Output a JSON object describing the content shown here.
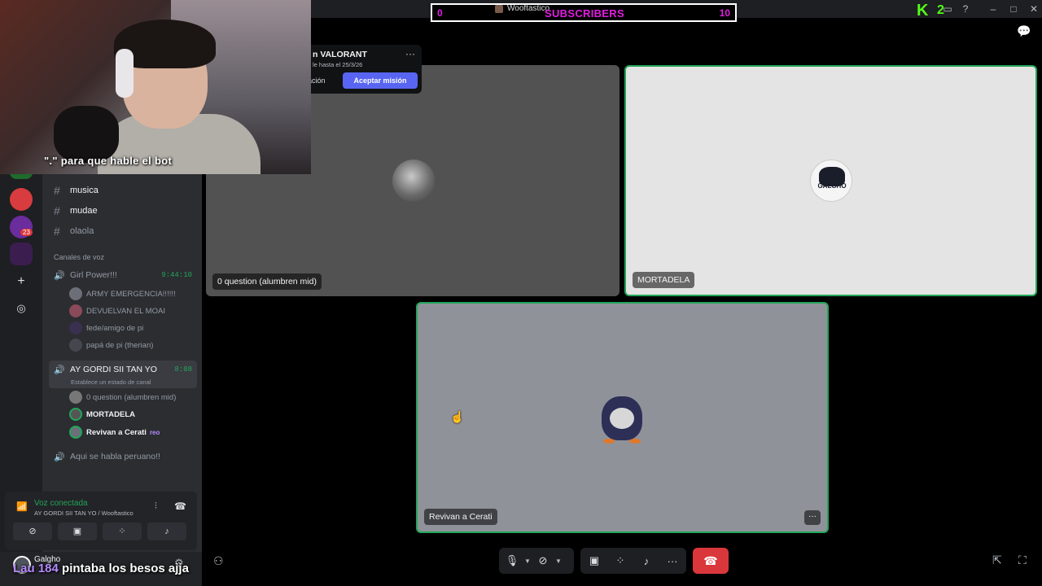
{
  "overlay": {
    "subscribers_label": "SUBSCRIBERS",
    "subscribers_left": "0",
    "subscribers_right": "10",
    "stream_user": "Wooftastico",
    "k_count": "2",
    "webcam_caption": "\".\" para que hable el bot",
    "bottom_caption_prefix": "Lau 184",
    "bottom_caption_text": "pintaba los besos ajja"
  },
  "mission": {
    "title": "n VALORANT",
    "subtitle": "le hasta el 25/3/26",
    "secondary_button": "ación",
    "primary_button": "Aceptar misión"
  },
  "channels": {
    "text": [
      {
        "name": "musica"
      },
      {
        "name": "mudae"
      },
      {
        "name": "olaola"
      }
    ],
    "voice_category": "Canales de voz",
    "voice": [
      {
        "name": "Girl Power!!!",
        "time": "9:44:10"
      },
      {
        "name": "AY GORDI SII TAN YO",
        "time": "8:08",
        "status": "Establece un estado de canal"
      },
      {
        "name": "Aqui se habla peruano!!"
      }
    ],
    "girlpower_users": [
      "ARMY EMERGENCIA!!!!!!",
      "DEVUELVAN EL MOAI",
      "fede/amigo de pi",
      "papá de pi (therian)"
    ],
    "gordi_users": [
      "0 question (alumbren mid)",
      "MORTADELA",
      "Revivan a Cerati"
    ],
    "gordi_user_tag": "reo"
  },
  "servers": {
    "badge": "23"
  },
  "voice_panel": {
    "title": "Voz conectada",
    "subtitle": "AY GORDI SII TAN YO / Wooftastico"
  },
  "user_panel": {
    "name": "Galgho"
  },
  "tiles": [
    {
      "name": "0 question (alumbren mid)"
    },
    {
      "name": "MORTADELA",
      "avatar_text": "GALGHO"
    },
    {
      "name": "Revivan a Cerati"
    }
  ],
  "colors": {
    "accent": "#5865f2",
    "connected": "#23a55a",
    "hangup": "#da373c",
    "subscribers": "#e21de0",
    "kick": "#53fc18"
  }
}
